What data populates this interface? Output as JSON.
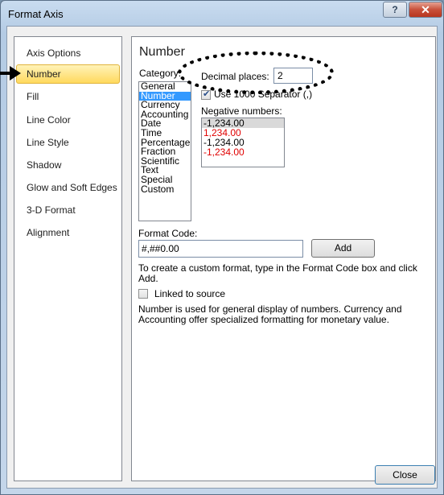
{
  "window": {
    "title": "Format Axis",
    "help_label": "?",
    "close_label": "✕"
  },
  "nav": {
    "items": [
      "Axis Options",
      "Number",
      "Fill",
      "Line Color",
      "Line Style",
      "Shadow",
      "Glow and Soft Edges",
      "3-D Format",
      "Alignment"
    ],
    "selected": "Number"
  },
  "panel": {
    "title": "Number",
    "category_label": "Category:",
    "categories": [
      "General",
      "Number",
      "Currency",
      "Accounting",
      "Date",
      "Time",
      "Percentage",
      "Fraction",
      "Scientific",
      "Text",
      "Special",
      "Custom"
    ],
    "selected_category": "Number",
    "decimal_label": "Decimal places:",
    "decimal_value": "2",
    "separator_label": "Use 1000 Separator (,)",
    "separator_checked": true,
    "negative_label": "Negative numbers:",
    "negative_options": [
      {
        "text": "-1,234.00",
        "color": "#000000"
      },
      {
        "text": "1,234.00",
        "color": "#e00000"
      },
      {
        "text": "-1,234.00",
        "color": "#000000"
      },
      {
        "text": "-1,234.00",
        "color": "#e00000"
      }
    ],
    "format_code_label": "Format Code:",
    "format_code_value": "#,##0.00",
    "add_label": "Add",
    "custom_hint": "To create a custom format, type in the Format Code box and click Add.",
    "linked_label": "Linked to source",
    "linked_checked": false,
    "footer_text": "Number is used for general display of numbers.  Currency and Accounting offer specialized formatting for monetary value."
  },
  "footer": {
    "close_label": "Close"
  },
  "colors": {
    "accent_selected": "#ffd95e",
    "list_selection": "#3399ff",
    "negative_red": "#e00000"
  }
}
